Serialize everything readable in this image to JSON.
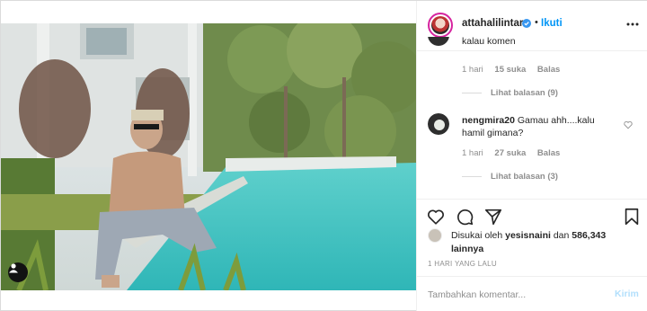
{
  "post": {
    "author": "attahalilintar",
    "follow_label": "Ikuti",
    "separator": "•",
    "verified": true,
    "accent": "#0095f6"
  },
  "comments": [
    {
      "text_fragment": "kalau komen",
      "time": "1 hari",
      "likes": "15 suka",
      "reply_label": "Balas",
      "view_replies": "Lihat balasan (9)"
    },
    {
      "username": "nengmira20",
      "text": "Gamau ahh....kalu hamil gimana?",
      "time": "1 hari",
      "likes": "27 suka",
      "reply_label": "Balas",
      "view_replies": "Lihat balasan (3)"
    }
  ],
  "likes": {
    "prefix": "Disukai oleh",
    "user": "yesisnaini",
    "conj": "dan",
    "count": "586,343 lainnya"
  },
  "timestamp": "1 HARI YANG LALU",
  "comment_box": {
    "placeholder": "Tambahkan komentar...",
    "post_label": "Kirim"
  },
  "icons": [
    "verified-icon",
    "more-icon",
    "heart-icon",
    "comment-icon",
    "share-icon",
    "bookmark-icon",
    "user-tag-icon"
  ]
}
